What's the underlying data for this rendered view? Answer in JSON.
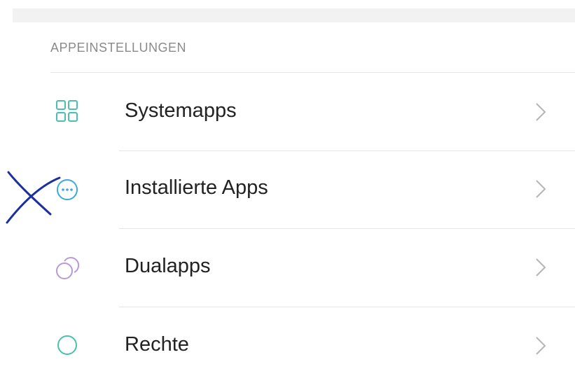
{
  "section": {
    "title": "APPEINSTELLUNGEN"
  },
  "items": [
    {
      "label": "Systemapps",
      "icon": "grid-icon",
      "color": "#4dbfae"
    },
    {
      "label": "Installierte Apps",
      "icon": "more-circle-icon",
      "color": "#3fa9d6"
    },
    {
      "label": "Dualapps",
      "icon": "dual-circles-icon",
      "color": "#b79ad8"
    },
    {
      "label": "Rechte",
      "icon": "circle-icon",
      "color": "#4dbfae"
    }
  ],
  "annotation": {
    "color": "#1b2fa0"
  },
  "chevron_color": "#b5b5b5"
}
